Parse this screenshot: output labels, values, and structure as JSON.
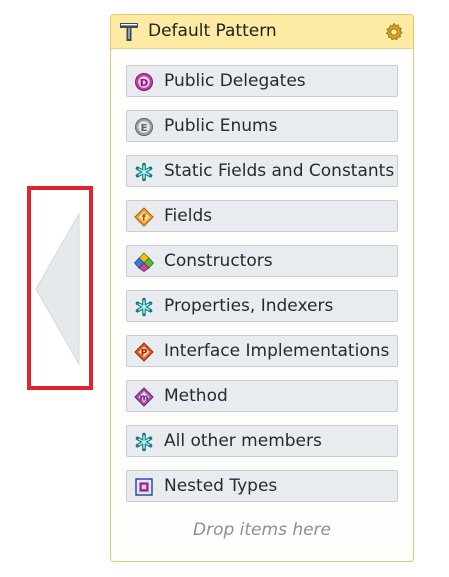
{
  "panel": {
    "title": "Default Pattern",
    "header_icon": "pattern-t-icon",
    "settings_icon": "gear-icon",
    "drop_hint": "Drop items here"
  },
  "items": [
    {
      "label": "Public Delegates",
      "icon": "delegate-icon",
      "icon_letter": "D"
    },
    {
      "label": "Public Enums",
      "icon": "enum-icon",
      "icon_letter": "E"
    },
    {
      "label": "Static Fields and Constants",
      "icon": "static-member-icon"
    },
    {
      "label": "Fields",
      "icon": "field-icon",
      "icon_letter": "f"
    },
    {
      "label": "Constructors",
      "icon": "constructor-icon"
    },
    {
      "label": "Properties, Indexers",
      "icon": "property-icon"
    },
    {
      "label": "Interface Implementations",
      "icon": "interface-implementation-icon",
      "icon_letter": "P"
    },
    {
      "label": "Method",
      "icon": "method-icon",
      "icon_letter": "m"
    },
    {
      "label": "All other members",
      "icon": "other-members-icon"
    },
    {
      "label": "Nested Types",
      "icon": "nested-type-icon"
    }
  ],
  "colors": {
    "highlight": "#e0242f",
    "header_bg": "#fdeaa3",
    "panel_border": "#e7c766",
    "item_bg": "#e9ecee"
  }
}
